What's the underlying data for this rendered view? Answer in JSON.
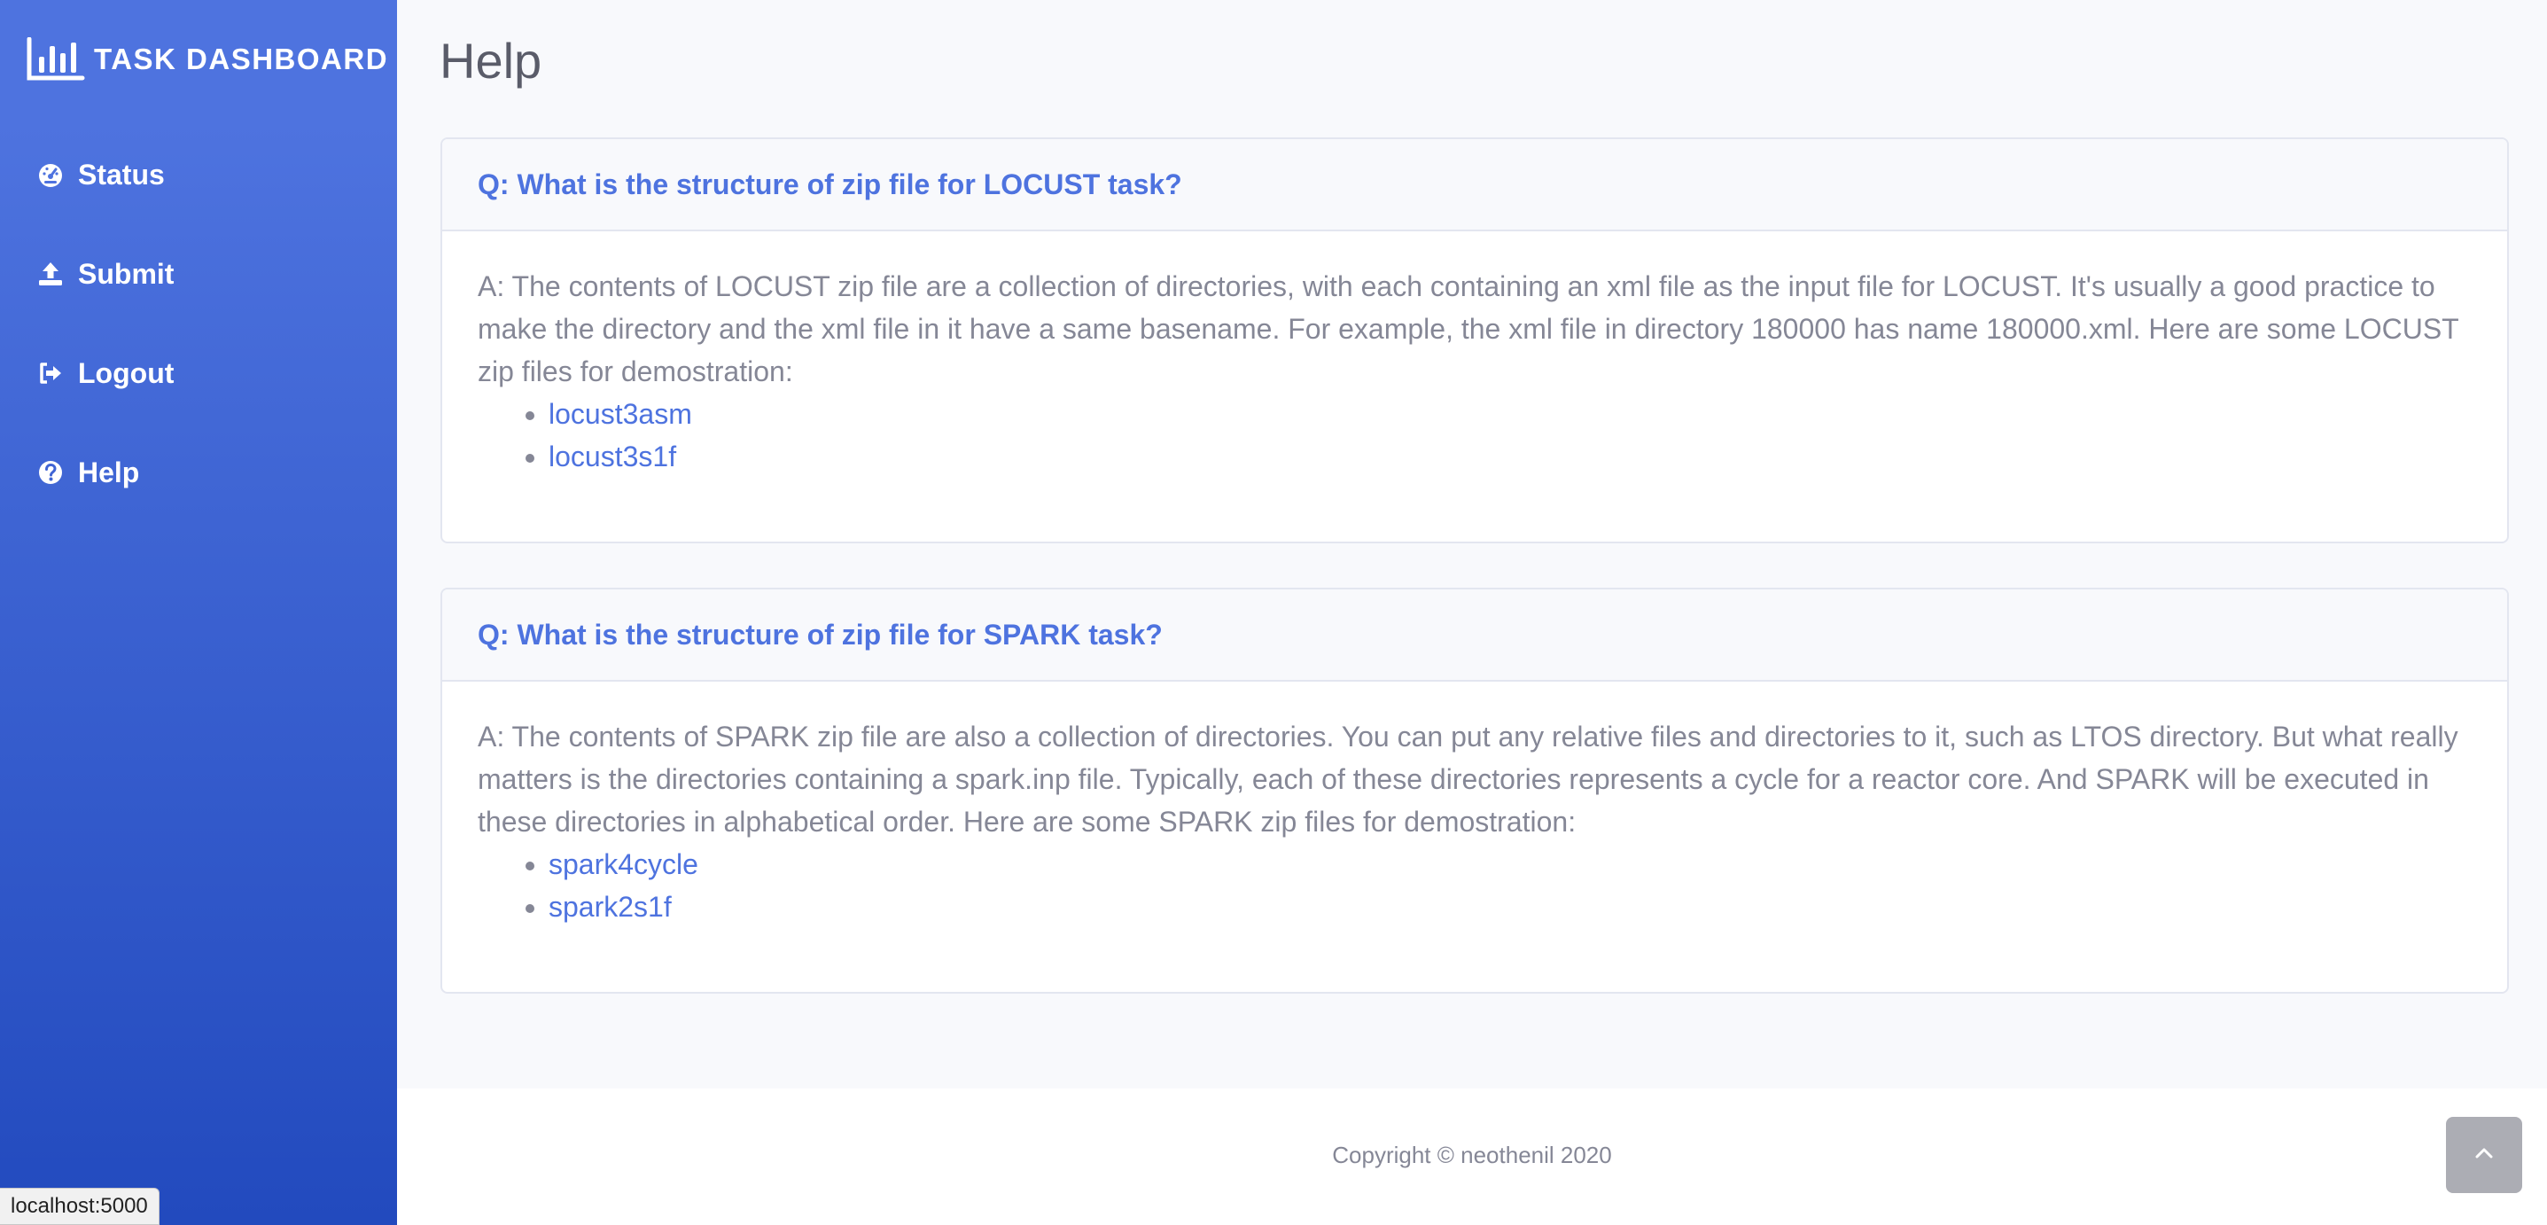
{
  "sidebar": {
    "brand": {
      "icon": "chart-bar-icon",
      "text": "TASK DASHBOARD"
    },
    "items": [
      {
        "label": "Status",
        "icon": "tachometer-icon"
      },
      {
        "label": "Submit",
        "icon": "upload-icon"
      },
      {
        "label": "Logout",
        "icon": "sign-out-icon"
      },
      {
        "label": "Help",
        "icon": "question-circle-icon"
      }
    ]
  },
  "main": {
    "title": "Help",
    "faq": [
      {
        "question": "Q: What is the structure of zip file for LOCUST task?",
        "answer": "A: The contents of LOCUST zip file are a collection of directories, with each containing an xml file as the input file for LOCUST. It's usually a good practice to make the directory and the xml file in it have a same basename. For example, the xml file in directory 180000 has name 180000.xml. Here are some LOCUST zip files for demostration:",
        "links": [
          "locust3asm",
          "locust3s1f"
        ]
      },
      {
        "question": "Q: What is the structure of zip file for SPARK task?",
        "answer": "A: The contents of SPARK zip file are also a collection of directories. You can put any relative files and directories to it, such as LTOS directory. But what really matters is the directories containing a spark.inp file. Typically, each of these directories represents a cycle for a reactor core. And SPARK will be executed in these directories in alphabetical order. Here are some SPARK zip files for demostration:",
        "links": [
          "spark4cycle",
          "spark2s1f"
        ]
      }
    ]
  },
  "footer": {
    "copyright": "Copyright © neothenil 2020",
    "scroll_top_icon": "chevron-up-icon"
  },
  "browser": {
    "status_url": "localhost:5000"
  },
  "colors": {
    "primary": "#4e73df",
    "sidebar_gradient_end": "#224abe",
    "text": "#858796",
    "heading": "#5a5c69"
  }
}
